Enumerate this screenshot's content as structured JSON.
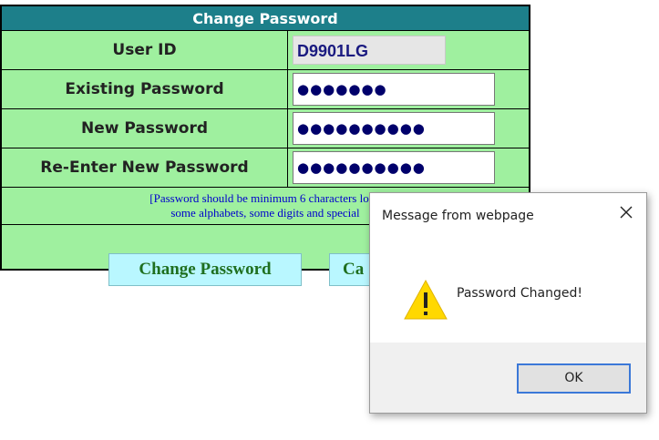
{
  "form": {
    "title": "Change Password",
    "rows": [
      {
        "label": "User ID",
        "value": "D9901LG"
      },
      {
        "label": "Existing Password",
        "value": "●●●●●●●"
      },
      {
        "label": "New Password",
        "value": "●●●●●●●●●●"
      },
      {
        "label": "Re-Enter New Password",
        "value": "●●●●●●●●●●"
      }
    ],
    "note_line1": "[Password should be minimum 6 characters long",
    "note_line2": "some alphabets, some digits and special",
    "change_button": "Change Password",
    "cancel_button_visible": "Ca"
  },
  "dialog": {
    "title": "Message from webpage",
    "message": "Password Changed!",
    "ok_label": "OK",
    "icon": "warning-icon"
  },
  "colors": {
    "header_bg": "#1d7f8a",
    "row_bg": "#9ff09f",
    "button_bg": "#b9f7ff",
    "note_text": "#0000cc",
    "warning_yellow": "#ffd800"
  }
}
